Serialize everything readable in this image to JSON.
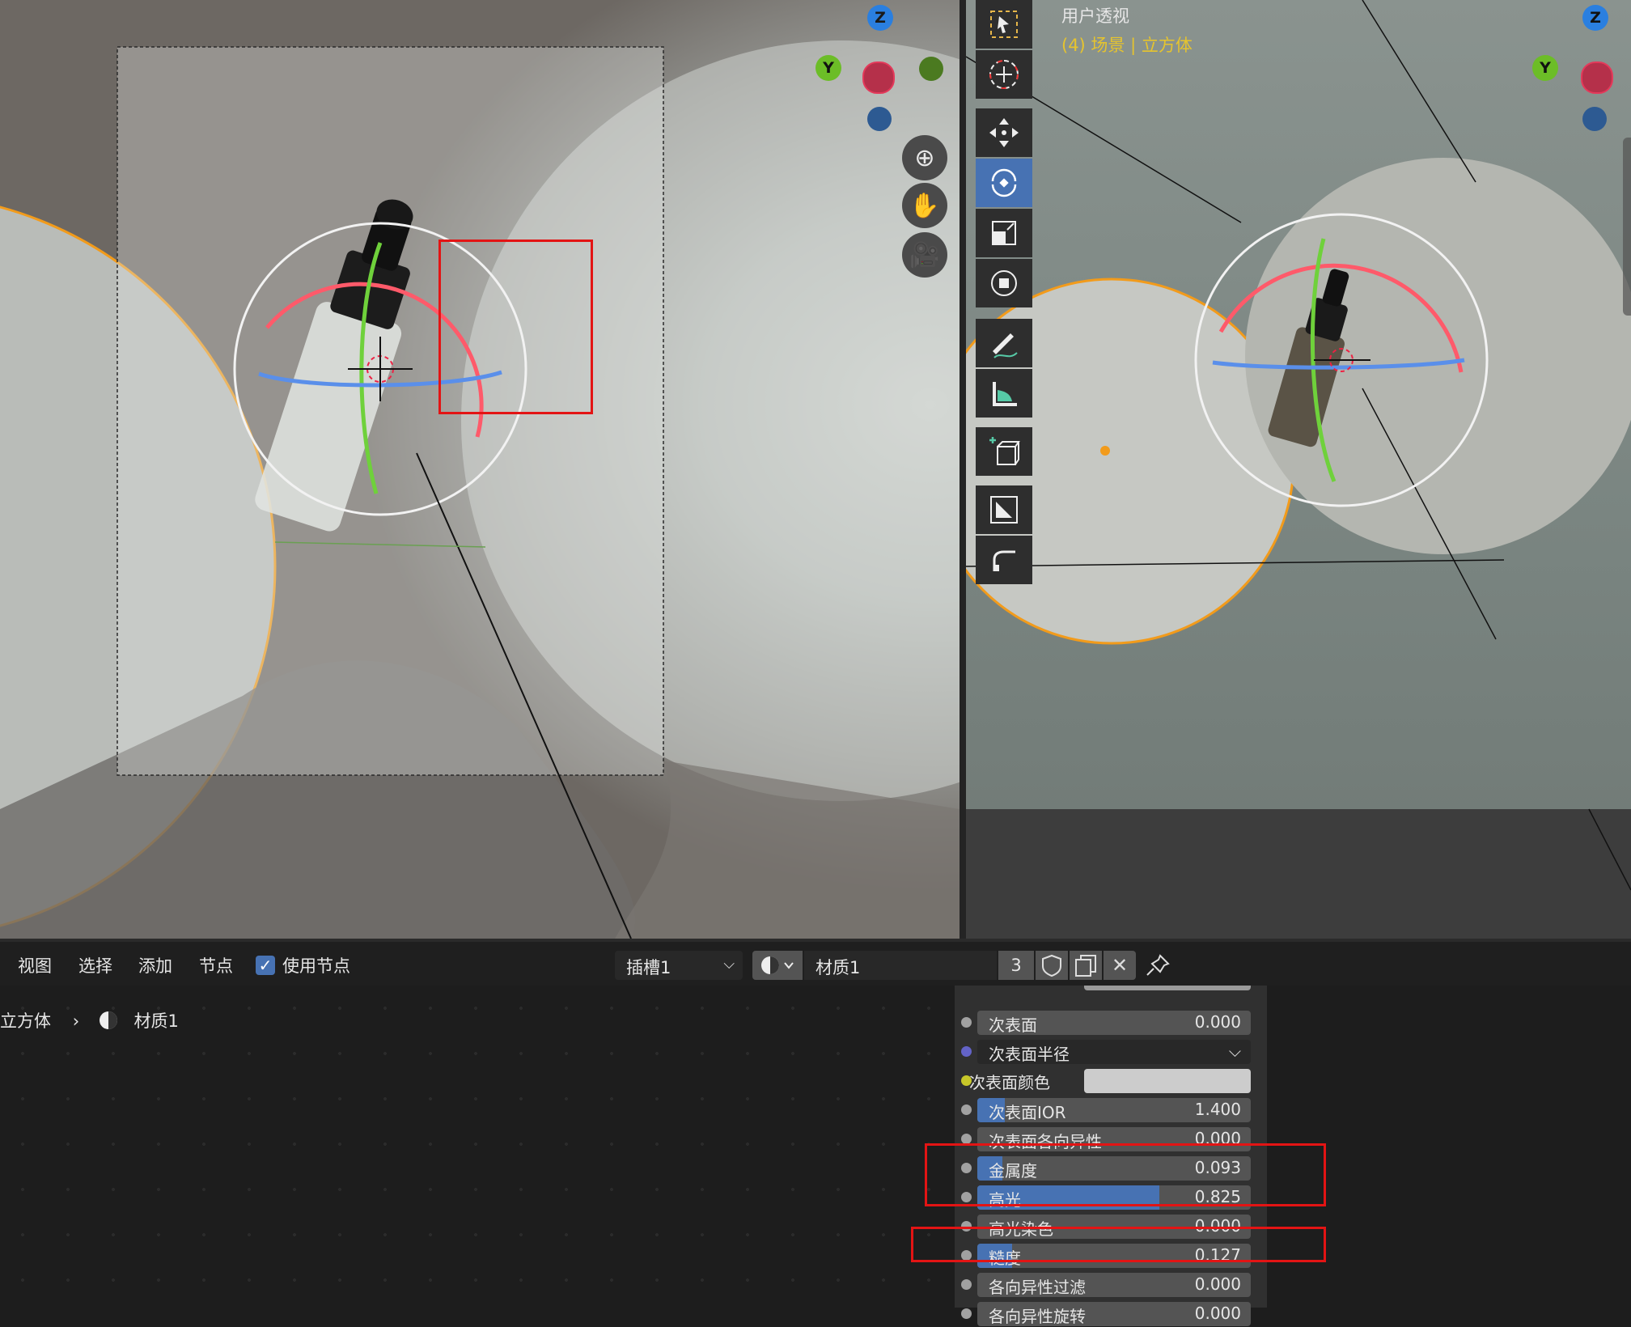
{
  "viewport_left": {
    "nav_icons": [
      "zoom-icon",
      "hand-icon",
      "camera-icon"
    ],
    "gizmo": {
      "z": "Z",
      "y": "Y"
    }
  },
  "viewport_right": {
    "title": "用户透视",
    "subtitle": "(4) 场景 | 立方体",
    "gizmo": {
      "z": "Z",
      "y": "Y"
    },
    "tools": [
      "select-box-icon",
      "cursor-icon",
      "move-icon",
      "rotate-icon",
      "scale-icon",
      "transform-icon",
      "annotate-icon",
      "measure-icon",
      "add-cube-icon",
      "inset-icon",
      "bevel-icon"
    ],
    "active_tool": "rotate-icon"
  },
  "node_editor": {
    "menu": {
      "view": "视图",
      "select": "选择",
      "add": "添加",
      "node": "节点"
    },
    "use_nodes": {
      "label": "使用节点",
      "checked": true
    },
    "slot": "插槽1",
    "material_name": "材质1",
    "users": "3",
    "breadcrumb": {
      "object": "立方体",
      "material": "材质1"
    },
    "properties": [
      {
        "label": "次表面",
        "value": "0.000",
        "fraction": 0.0,
        "socket_color": "#a1a1a1"
      },
      {
        "label": "次表面半径",
        "value": "",
        "dropdown": true,
        "socket_color": "#6363c7"
      },
      {
        "label": "次表面颜色",
        "value": "",
        "color_swatch": "#cccccc",
        "socket_color": "#c7c729"
      },
      {
        "label": "次表面IOR",
        "value": "1.400",
        "fraction": 0.1,
        "socket_color": "#a1a1a1"
      },
      {
        "label": "次表面各向异性",
        "value": "0.000",
        "fraction": 0.0,
        "socket_color": "#a1a1a1"
      },
      {
        "label": "金属度",
        "value": "0.093",
        "fraction": 0.093,
        "socket_color": "#a1a1a1"
      },
      {
        "label": "高光",
        "value": "0.825",
        "fraction": 0.665,
        "socket_color": "#a1a1a1"
      },
      {
        "label": "高光染色",
        "value": "0.000",
        "fraction": 0.0,
        "socket_color": "#a1a1a1"
      },
      {
        "label": "糙度",
        "value": "0.127",
        "fraction": 0.127,
        "socket_color": "#a1a1a1"
      },
      {
        "label": "各向异性过滤",
        "value": "0.000",
        "fraction": 0.0,
        "socket_color": "#a1a1a1"
      },
      {
        "label": "各向异性旋转",
        "value": "0.000",
        "fraction": 0.0,
        "socket_color": "#a1a1a1"
      }
    ]
  },
  "colors": {
    "accent": "#4772b3",
    "highlight_box": "#e31414",
    "selection_outline": "#f5a623"
  }
}
